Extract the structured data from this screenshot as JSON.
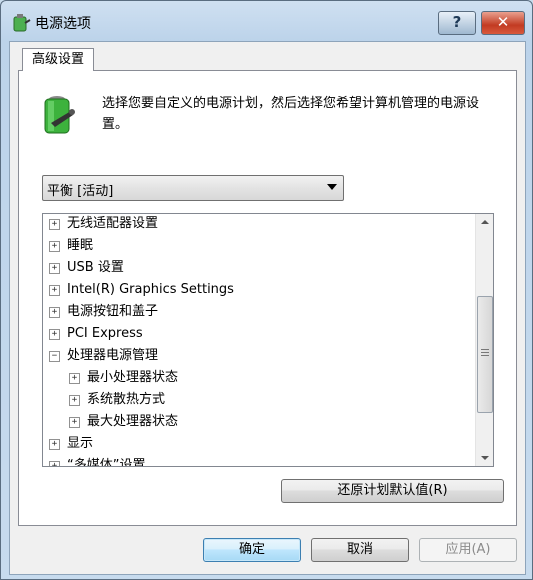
{
  "window": {
    "title": "电源选项",
    "help_glyph": "?",
    "close_glyph": "✕"
  },
  "tabs": [
    {
      "label": "高级设置"
    }
  ],
  "description": "选择您要自定义的电源计划，然后选择您希望计算机管理的电源设置。",
  "plan_select": {
    "selected": "平衡 [活动]"
  },
  "tree": {
    "items": [
      {
        "label": "无线适配器设置",
        "state": "+",
        "level": 0
      },
      {
        "label": "睡眠",
        "state": "+",
        "level": 0
      },
      {
        "label": "USB 设置",
        "state": "+",
        "level": 0
      },
      {
        "label": "Intel(R) Graphics Settings",
        "state": "+",
        "level": 0
      },
      {
        "label": "电源按钮和盖子",
        "state": "+",
        "level": 0
      },
      {
        "label": "PCI Express",
        "state": "+",
        "level": 0
      },
      {
        "label": "处理器电源管理",
        "state": "−",
        "level": 0
      },
      {
        "label": "最小处理器状态",
        "state": "+",
        "level": 1
      },
      {
        "label": "系统散热方式",
        "state": "+",
        "level": 1
      },
      {
        "label": "最大处理器状态",
        "state": "+",
        "level": 1
      },
      {
        "label": "显示",
        "state": "+",
        "level": 0
      },
      {
        "label": "“多媒体”设置",
        "state": "+",
        "level": 0
      }
    ]
  },
  "buttons": {
    "restore": "还原计划默认值(R)",
    "ok": "确定",
    "cancel": "取消",
    "apply": "应用(A)"
  },
  "colors": {
    "close": "#c23b22",
    "battery_green": "#3db23d",
    "default_button_border": "#3c7fb1",
    "disabled_text": "#8b8b8b"
  }
}
